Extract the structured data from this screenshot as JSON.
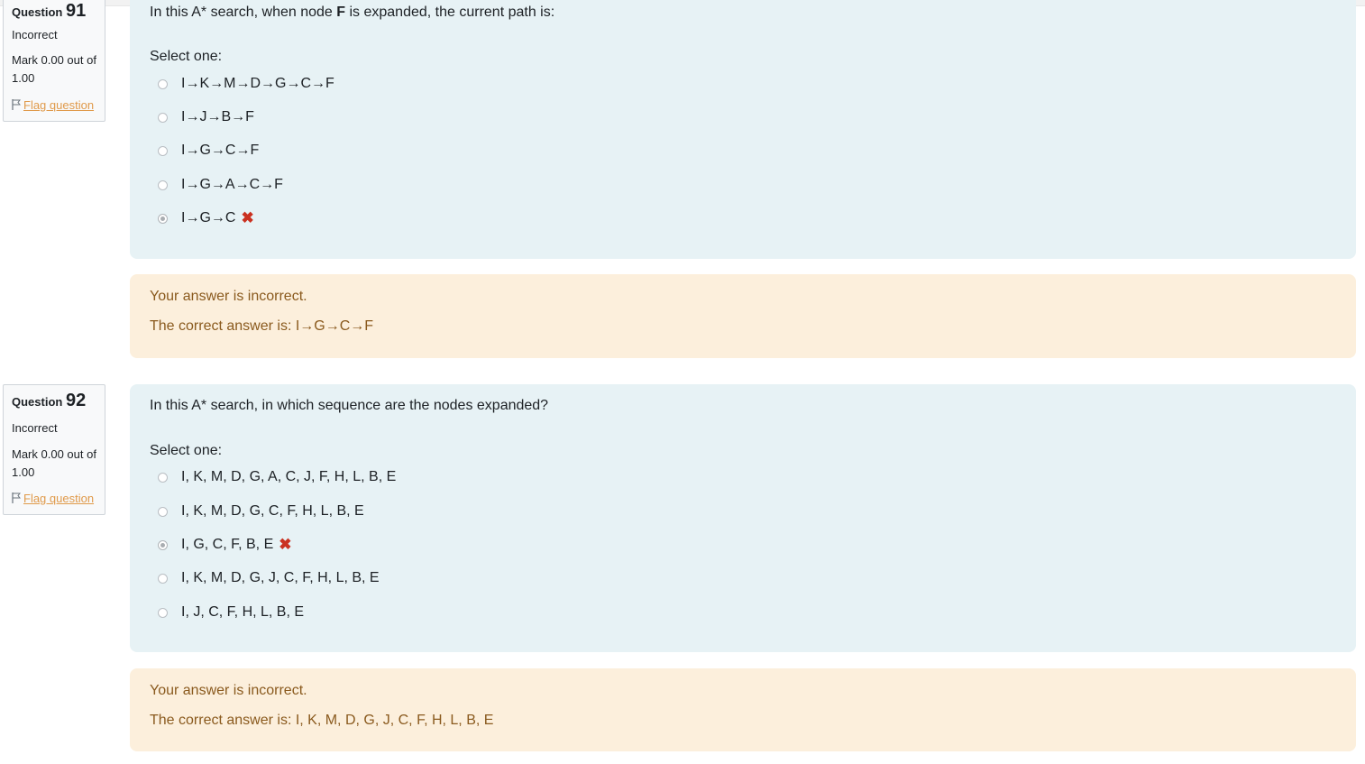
{
  "questions": [
    {
      "label": "Question",
      "number": "91",
      "state": "Incorrect",
      "mark": "Mark 0.00 out of 1.00",
      "flag_label": "Flag question",
      "text_before": "In this A* search, when node ",
      "text_bold": "F",
      "text_after": " is expanded, the current path is:",
      "prompt": "Select one:",
      "options": [
        {
          "label": "I→K→M→D→G→C→F",
          "checked": false
        },
        {
          "label": "I→J→B→F",
          "checked": false
        },
        {
          "label": "I→G→C→F",
          "checked": false
        },
        {
          "label": "I→G→A→C→F",
          "checked": false
        },
        {
          "label": "I→G→C",
          "checked": true,
          "mark": "✖"
        }
      ],
      "feedback": "Your answer is incorrect.",
      "correct": "The correct answer is: I→G→C→F"
    },
    {
      "label": "Question",
      "number": "92",
      "state": "Incorrect",
      "mark": "Mark 0.00 out of 1.00",
      "flag_label": "Flag question",
      "text": "In this A* search, in which sequence are the nodes expanded?",
      "prompt": "Select one:",
      "options": [
        {
          "label": "I, K, M, D, G, A, C, J, F, H, L, B, E",
          "checked": false
        },
        {
          "label": "I, K, M, D, G, C, F, H, L, B, E",
          "checked": false
        },
        {
          "label": "I, G, C, F, B, E",
          "checked": true,
          "mark": "✖"
        },
        {
          "label": "I, K, M, D, G, J, C, F, H, L, B, E",
          "checked": false
        },
        {
          "label": "I, J, C, F, H, L, B, E",
          "checked": false
        }
      ],
      "feedback": "Your answer is incorrect.",
      "correct": "The correct answer is: I, K, M, D, G, J, C, F, H, L, B, E"
    }
  ],
  "colors": {
    "formulation_bg": "#e7f2f5",
    "feedback_bg": "#fcefdc",
    "feedback_text": "#8a5a1e",
    "incorrect_mark": "#ca3120",
    "flag_link": "#e09a4a"
  }
}
